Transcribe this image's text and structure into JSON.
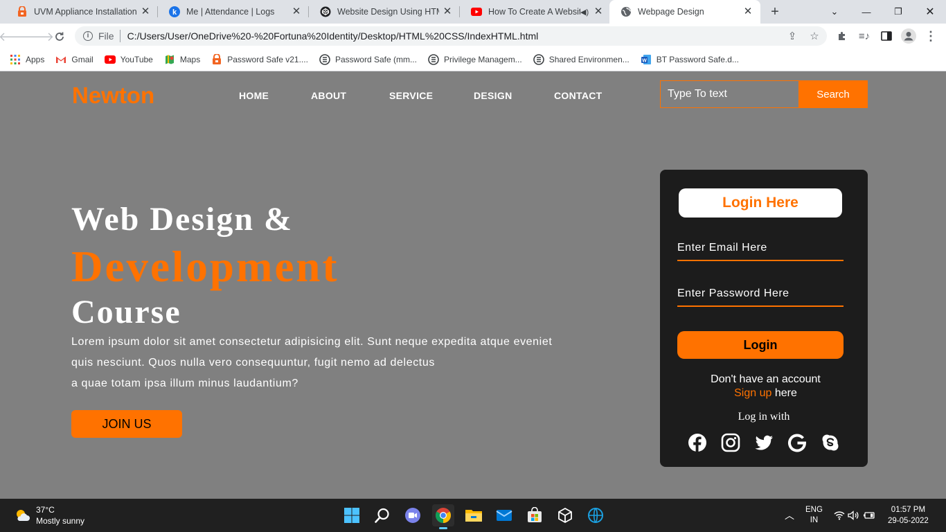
{
  "browser": {
    "tabs": [
      {
        "title": "UVM Appliance Installation G",
        "icon": "uvm-favicon-icon",
        "active": false
      },
      {
        "title": "Me | Attendance | Logs",
        "icon": "k-favicon-icon",
        "active": false
      },
      {
        "title": "Website Design Using HTML",
        "icon": "codepen-favicon-icon",
        "active": false
      },
      {
        "title": "How To Create A Website",
        "icon": "youtube-favicon-icon",
        "active": false,
        "audio": true
      },
      {
        "title": "Webpage Design",
        "icon": "globe-favicon-icon",
        "active": true
      }
    ],
    "address": {
      "scheme": "File",
      "url": "C:/Users/User/OneDrive%20-%20Fortuna%20Identity/Desktop/HTML%20CSS/IndexHTML.html"
    },
    "bookmarks": [
      {
        "label": "Apps",
        "icon": "apps-grid-icon"
      },
      {
        "label": "Gmail",
        "icon": "gmail-icon"
      },
      {
        "label": "YouTube",
        "icon": "youtube-icon"
      },
      {
        "label": "Maps",
        "icon": "maps-icon"
      },
      {
        "label": "Password Safe v21....",
        "icon": "password-safe-icon"
      },
      {
        "label": "Password Safe (mm...",
        "icon": "bt-icon"
      },
      {
        "label": "Privilege Managem...",
        "icon": "bt-icon"
      },
      {
        "label": "Shared Environmen...",
        "icon": "bt-icon"
      },
      {
        "label": "BT Password Safe.d...",
        "icon": "word-icon"
      }
    ]
  },
  "site": {
    "logo": "Newton",
    "nav": [
      "HOME",
      "ABOUT",
      "SERVICE",
      "DESIGN",
      "CONTACT"
    ],
    "search": {
      "placeholder": "Type To text",
      "button": "Search"
    },
    "hero": {
      "line1": "Web Design &",
      "line2": "Development",
      "line3": "Course",
      "paragraph": [
        "Lorem ipsum dolor sit amet consectetur adipisicing elit. Sunt neque expedita atque eveniet",
        "quis nesciunt. Quos nulla vero consequuntur, fugit nemo ad delectus",
        "a quae totam ipsa illum minus laudantium?"
      ],
      "cta": "JOIN US"
    },
    "login": {
      "title": "Login Here",
      "email_placeholder": "Enter Email Here",
      "password_placeholder": "Enter Password Here",
      "button": "Login",
      "no_account": "Don't have an account",
      "signup_link": "Sign up",
      "signup_suffix": " here",
      "login_with": "Log in with",
      "socials": [
        "facebook-icon",
        "instagram-icon",
        "twitter-icon",
        "google-icon",
        "skype-icon"
      ]
    },
    "accent_color": "#ff7200",
    "background_color": "#808080",
    "card_color": "#1c1c1c"
  },
  "taskbar": {
    "weather": {
      "temp": "37°C",
      "condition": "Mostly sunny"
    },
    "apps": [
      "windows-start-icon",
      "search-icon",
      "chat-icon",
      "chrome-icon",
      "file-explorer-icon",
      "mail-icon",
      "store-icon",
      "box-app-icon",
      "browser-globe-icon"
    ],
    "language": {
      "lang": "ENG",
      "region": "IN"
    },
    "clock": {
      "time": "01:57 PM",
      "date": "29-05-2022"
    }
  }
}
